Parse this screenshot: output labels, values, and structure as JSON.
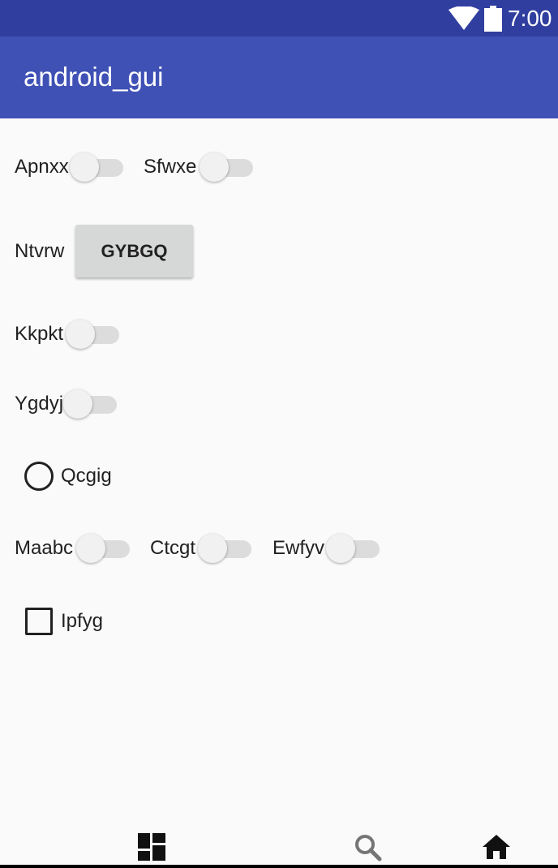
{
  "status_bar": {
    "time": "7:00",
    "wifi_icon": "wifi-icon",
    "battery_icon": "battery-icon"
  },
  "app_bar": {
    "title": "android_gui"
  },
  "form": {
    "switch_apnxx": {
      "label": "Apnxx",
      "checked": false
    },
    "switch_sfwxe": {
      "label": "Sfwxe",
      "checked": false
    },
    "button_row": {
      "label": "Ntvrw",
      "button_label": "GYBGQ"
    },
    "switch_kkpkt": {
      "label": "Kkpkt",
      "checked": false
    },
    "switch_ygdyj": {
      "label": "Ygdyj",
      "checked": false
    },
    "radio_qcgig": {
      "label": "Qcgig",
      "checked": false
    },
    "switch_maabc": {
      "label": "Maabc",
      "checked": false
    },
    "switch_ctcgt": {
      "label": "Ctcgt",
      "checked": false
    },
    "switch_ewfyv": {
      "label": "Ewfyv",
      "checked": false
    },
    "checkbox_ipfyg": {
      "label": "Ipfyg",
      "checked": false
    }
  },
  "bottom_nav": {
    "items": [
      {
        "icon": "dashboard-icon"
      },
      {
        "icon": "search-icon"
      },
      {
        "icon": "home-icon"
      }
    ]
  },
  "colors": {
    "primary": "#3f51b5",
    "primary_dark": "#303f9f",
    "background": "#fafafa"
  }
}
